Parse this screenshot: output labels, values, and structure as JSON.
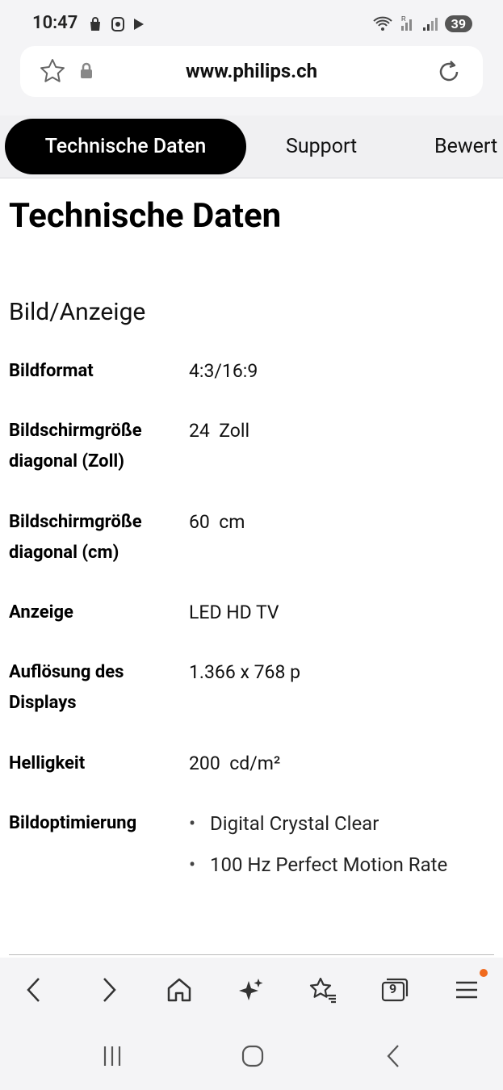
{
  "status_bar": {
    "time": "10:47",
    "battery": "39",
    "left_icons": [
      "shopping-bag-icon",
      "alarm-icon",
      "play-store-icon"
    ],
    "right_icons": [
      "wifi-icon",
      "signal-roaming-icon",
      "signal-icon"
    ]
  },
  "browser": {
    "url": "www.philips.ch"
  },
  "tabs": [
    {
      "label": "Technische Daten",
      "active": true
    },
    {
      "label": "Support",
      "active": false
    },
    {
      "label": "Bewert",
      "active": false
    }
  ],
  "content": {
    "title": "Technische Daten",
    "section": "Bild/Anzeige",
    "specs": [
      {
        "label": "Bildformat",
        "value": "4:3/16:9"
      },
      {
        "label": "Bildschirmgröße diagonal (Zoll)",
        "value": "24  Zoll"
      },
      {
        "label": "Bildschirmgröße diagonal (cm)",
        "value": "60  cm"
      },
      {
        "label": "Anzeige",
        "value": "LED HD TV"
      },
      {
        "label": "Auflösung des Displays",
        "value": "1.366 x 768 p"
      },
      {
        "label": "Helligkeit",
        "value": "200  cd/m²"
      },
      {
        "label": "Bildoptimierung",
        "bullets": [
          "Digital Crystal Clear",
          "100 Hz Perfect Motion Rate"
        ]
      }
    ]
  },
  "bottom_nav": {
    "tab_count": "9",
    "notification_color": "#f06a1d",
    "items": [
      "back-icon",
      "forward-icon",
      "home-icon",
      "ai-sparkle-icon",
      "bookmarks-icon",
      "tabs-icon",
      "menu-icon"
    ]
  },
  "system_nav": [
    "recent-apps-icon",
    "home-button-icon",
    "system-back-icon"
  ]
}
